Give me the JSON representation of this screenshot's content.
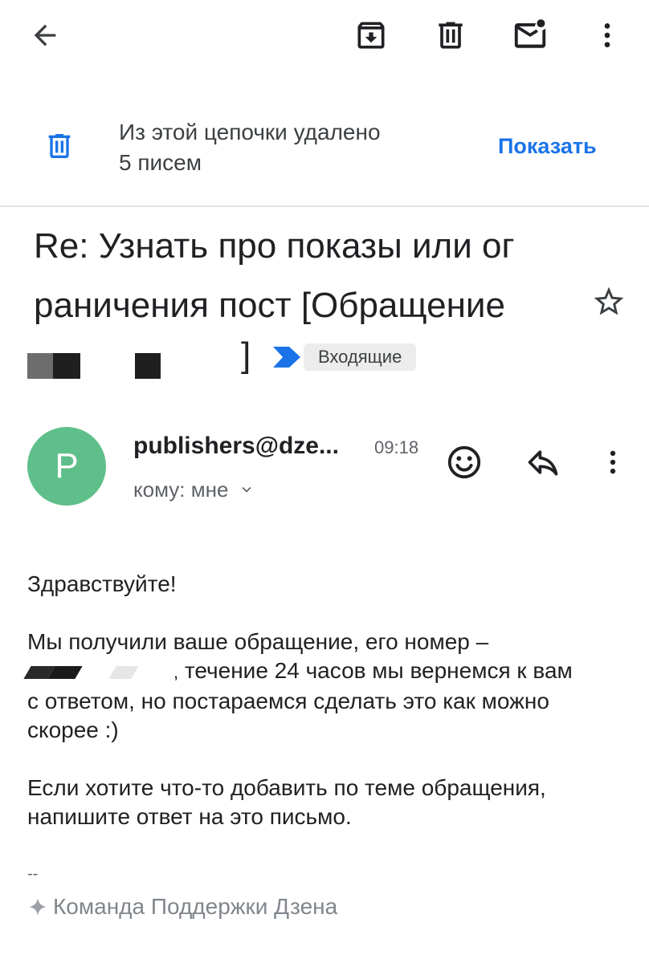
{
  "toolbar": {
    "icons": [
      "back-arrow-icon",
      "archive-icon",
      "trash-icon",
      "mark-unread-icon",
      "more-vert-icon"
    ]
  },
  "notice": {
    "line1": "Из этой цепочки удалено",
    "line2": "5 писем",
    "action": "Показать",
    "icon": "trash-icon",
    "accent": "#1a73e8"
  },
  "subject": {
    "line1": "Re: Узнать про показы или ог",
    "line2": "раничения пост [Обращение",
    "bracket_close": "]",
    "label": "Входящие",
    "label_arrow_color": "#1a73e8"
  },
  "message": {
    "avatar_letter": "P",
    "avatar_color": "#5fbf8a",
    "sender": "publishers@dze...",
    "time": "09:18",
    "recipient": "кому: мне",
    "body": {
      "greeting": "Здравствуйте!",
      "p1_line1": "Мы получили ваше обращение, его номер –",
      "p1_line2": "течение 24 часов мы вернемся к вам",
      "p1_line3": "с ответом, но постараемся сделать это как можно",
      "p1_line4": "скорее :)",
      "p2_line1": "Если хотите что-то добавить по теме обращения,",
      "p2_line2": "напишите ответ на это письмо."
    },
    "signature_separator": "--",
    "signature": "Команда Поддержки Дзена"
  }
}
